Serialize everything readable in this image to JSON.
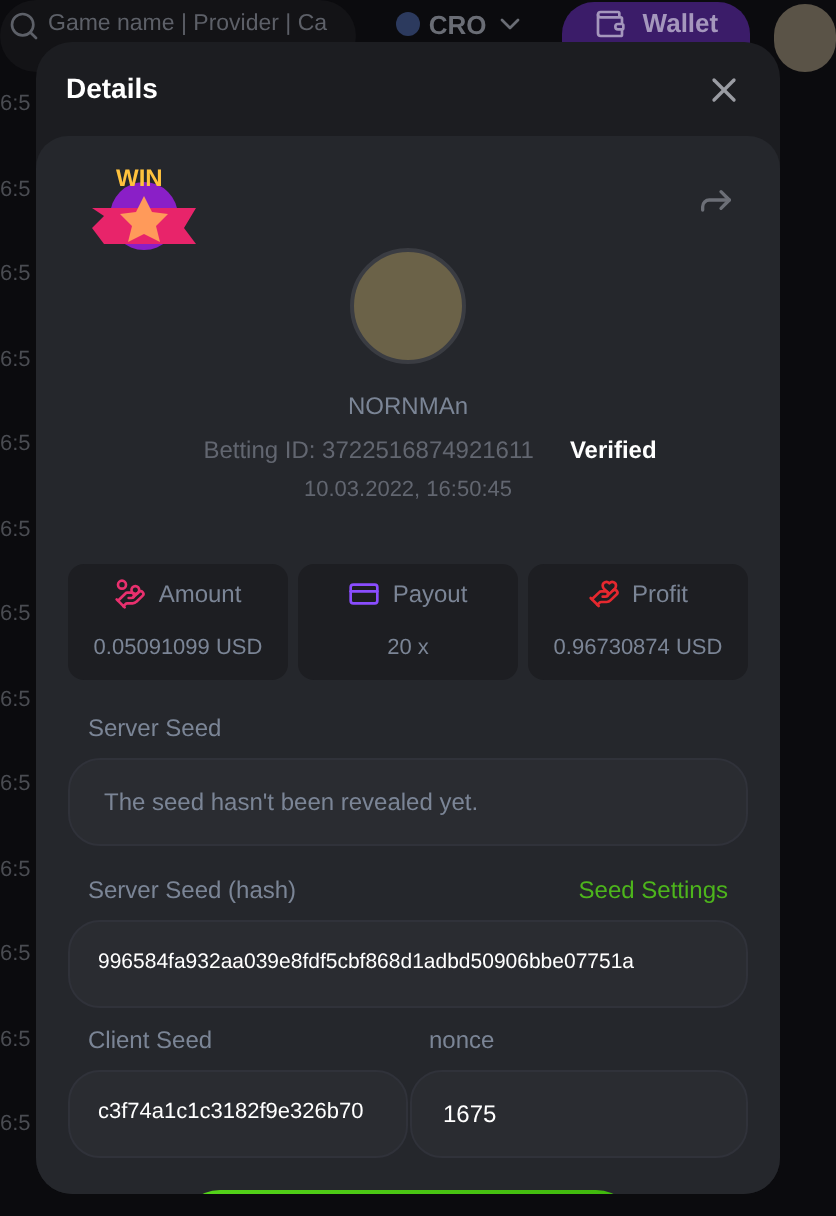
{
  "background": {
    "search": {
      "placeholder": "Game name | Provider | Ca"
    },
    "currency": "CRO",
    "wallet_button": "Wallet",
    "times": [
      "6:5",
      "6:5",
      "6:5",
      "6:5",
      "6:5",
      "6:5",
      "6:5",
      "6:5",
      "6:5",
      "6:5",
      "6:5",
      "6:5",
      "6:5"
    ]
  },
  "dialog": {
    "title": "Details",
    "badge": "WIN",
    "player": {
      "name": "NORNMAn",
      "betting_id": "Betting ID: 3722516874921611",
      "status": "Verified",
      "date": "10.03.2022, 16:50:45"
    },
    "stats": [
      {
        "kind": "amount",
        "label": "Amount",
        "value": "0.05091099 USD"
      },
      {
        "kind": "payout",
        "label": "Payout",
        "value": "20 x"
      },
      {
        "kind": "profit",
        "label": "Profit",
        "value": "0.96730874 USD"
      }
    ],
    "server_seed": {
      "label": "Server Seed",
      "value": "The seed hasn't been revealed yet."
    },
    "server_seed_hash": {
      "label": "Server Seed (hash)",
      "link": "Seed Settings",
      "value": "996584fa932aa039e8fdf5cbf868d1adbd50906bbe07751a"
    },
    "client_seed": {
      "label": "Client Seed",
      "value": "c3f74a1c1c3182f9e326b70"
    },
    "nonce": {
      "label": "nonce",
      "value": "1675"
    }
  }
}
